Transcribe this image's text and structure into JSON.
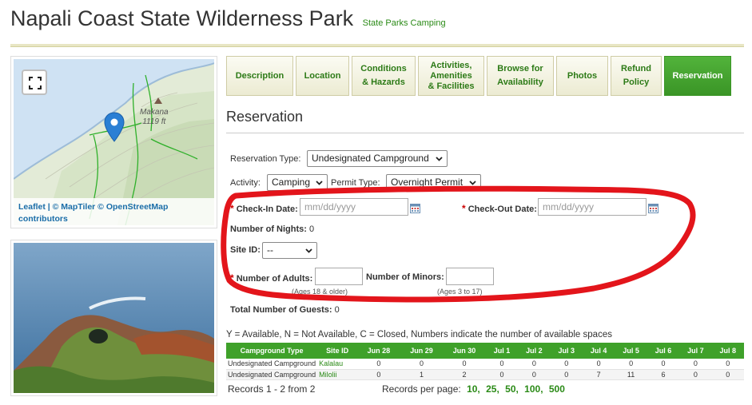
{
  "header": {
    "title": "Napali Coast State Wilderness Park",
    "subtitle": "State Parks Camping"
  },
  "map": {
    "peak_name": "Makana",
    "peak_elevation": "1119 ft",
    "attribution_line1": "Leaflet | © MapTiler © OpenStreetMap",
    "attribution_line2": "contributors",
    "fullscreen_icon": "fullscreen-icon",
    "marker_icon": "map-marker-icon"
  },
  "tabs": [
    {
      "label1": "Description",
      "label2": ""
    },
    {
      "label1": "Location",
      "label2": ""
    },
    {
      "label1": "Conditions",
      "label2": "& Hazards"
    },
    {
      "label1": "Activities,",
      "label2": "Amenities",
      "label3": "& Facilities"
    },
    {
      "label1": "Browse for",
      "label2": "Availability"
    },
    {
      "label1": "Photos",
      "label2": ""
    },
    {
      "label1": "Refund",
      "label2": "Policy"
    },
    {
      "label1": "Reservation",
      "label2": ""
    }
  ],
  "reservation": {
    "title": "Reservation",
    "reservation_type_label": "Reservation Type:",
    "reservation_type_value": "Undesignated Campground",
    "activity_label": "Activity:",
    "activity_value": "Camping",
    "permit_type_label": "Permit Type:",
    "permit_type_value": "Overnight Permit",
    "required_mark": "*",
    "checkin_label": "Check-In Date:",
    "checkin_placeholder": "mm/dd/yyyy",
    "checkout_label": "Check-Out Date:",
    "checkout_placeholder": "mm/dd/yyyy",
    "nights_label": "Number of Nights:",
    "nights_value": "0",
    "site_id_label": "Site ID:",
    "site_id_value": "--",
    "adults_label": "Number of Adults:",
    "adults_hint": "(Ages 18 & older)",
    "minors_label": "Number of Minors:",
    "minors_hint": "(Ages 3 to 17)",
    "guests_label": "Total Number of Guests:",
    "guests_value": "0"
  },
  "availability": {
    "legend": "Y = Available, N = Not Available, C = Closed, Numbers indicate the number of available spaces",
    "columns": [
      "Campground Type",
      "Site ID",
      "Jun 28",
      "Jun 29",
      "Jun 30",
      "Jul 1",
      "Jul 2",
      "Jul 3",
      "Jul 4",
      "Jul 5",
      "Jul 6",
      "Jul 7",
      "Jul 8"
    ],
    "rows": [
      {
        "type": "Undesignated Campground",
        "site": "Kalalau",
        "values": [
          "0",
          "0",
          "0",
          "0",
          "0",
          "0",
          "0",
          "0",
          "0",
          "0",
          "0"
        ]
      },
      {
        "type": "Undesignated Campground",
        "site": "Milolii",
        "values": [
          "0",
          "1",
          "2",
          "0",
          "0",
          "0",
          "7",
          "11",
          "6",
          "0",
          "0"
        ]
      }
    ],
    "records_text": "Records 1 - 2 from 2",
    "per_page_label": "Records per page:",
    "per_page_options": [
      "10,",
      "25,",
      "50,",
      "100,",
      "500"
    ]
  },
  "colors": {
    "accent_green": "#3fa12a",
    "link_green": "#2a8a16",
    "highlight_red": "#e3151b"
  }
}
